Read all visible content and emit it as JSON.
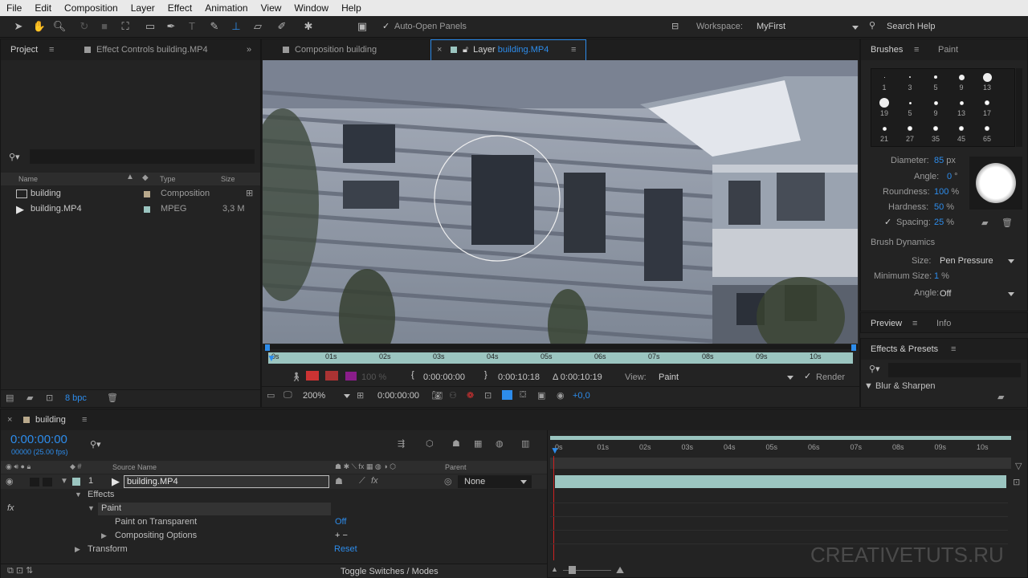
{
  "menu": [
    "File",
    "Edit",
    "Composition",
    "Layer",
    "Effect",
    "Animation",
    "View",
    "Window",
    "Help"
  ],
  "toolbar": {
    "auto_open": "Auto-Open Panels",
    "workspace_label": "Workspace:",
    "workspace_value": "MyFirst",
    "search_help": "Search Help"
  },
  "project_panel": {
    "tab_project": "Project",
    "tab_effect_controls": "Effect Controls building.MP4",
    "search_placeholder": "",
    "col_name": "Name",
    "col_type": "Type",
    "col_size": "Size",
    "items": [
      {
        "name": "building",
        "type": "Composition",
        "size": "",
        "color": "#b9a98c"
      },
      {
        "name": "building.MP4",
        "type": "MPEG",
        "size": "3,3 M",
        "color": "#9bc5c0"
      }
    ],
    "bpc": "8 bpc"
  },
  "viewer": {
    "tab_composition": "Composition building",
    "tab_layer_prefix": "Layer ",
    "tab_layer_name": "building.MP4",
    "ruler_labels": [
      "0s",
      "01s",
      "02s",
      "03s",
      "04s",
      "05s",
      "06s",
      "07s",
      "08s",
      "09s",
      "10s"
    ],
    "opacity": "100 %",
    "in_point": "0:00:00:00",
    "out_point": "0:00:10:18",
    "duration": "Δ 0:00:10:19",
    "view_label": "View:",
    "view_value": "Paint",
    "render_label": "Render",
    "zoom": "200%",
    "timecode": "0:00:00:00",
    "exposure": "+0,0"
  },
  "brushes": {
    "tab_brushes": "Brushes",
    "tab_paint": "Paint",
    "presets": [
      {
        "label": "1",
        "dot": 1
      },
      {
        "label": "3",
        "dot": 2
      },
      {
        "label": "5",
        "dot": 4
      },
      {
        "label": "9",
        "dot": 7
      },
      {
        "label": "13",
        "dot": 11
      },
      {
        "label": "19",
        "dot": 12
      },
      {
        "label": "5",
        "dot": 3
      },
      {
        "label": "9",
        "dot": 5
      },
      {
        "label": "13",
        "dot": 5
      },
      {
        "label": "17",
        "dot": 6
      },
      {
        "label": "21",
        "dot": 5
      },
      {
        "label": "27",
        "dot": 6
      },
      {
        "label": "35",
        "dot": 6
      },
      {
        "label": "45",
        "dot": 6
      },
      {
        "label": "65",
        "dot": 6
      }
    ],
    "diameter_label": "Diameter:",
    "diameter_value": "85",
    "diameter_unit": " px",
    "angle_label": "Angle:",
    "angle_value": "0",
    "angle_unit": " °",
    "roundness_label": "Roundness:",
    "roundness_value": "100",
    "roundness_unit": " %",
    "hardness_label": "Hardness:",
    "hardness_value": "50",
    "hardness_unit": " %",
    "spacing_label": "Spacing:",
    "spacing_value": "25",
    "spacing_unit": " %",
    "dynamics_label": "Brush Dynamics",
    "size_label": "Size:",
    "size_value": "Pen Pressure",
    "min_size_label": "Minimum Size:",
    "min_size_value": "1",
    "min_size_unit": " %",
    "dyn_angle_label": "Angle:",
    "dyn_angle_value": "Off"
  },
  "preview_panel": {
    "tab_preview": "Preview",
    "tab_info": "Info"
  },
  "effects_panel": {
    "title": "Effects & Presets",
    "search_placeholder": "",
    "category": "Blur & Sharpen"
  },
  "timeline": {
    "tab": "building",
    "timecode": "0:00:00:00",
    "fps": "00000 (25.00 fps)",
    "col_source": "Source Name",
    "col_parent": "Parent",
    "layer_number": "1",
    "layer_name": "building.MP4",
    "parent_value": "None",
    "effects": "Effects",
    "paint": "Paint",
    "paint_on_transparent": "Paint on Transparent",
    "paint_on_transparent_value": "Off",
    "compositing_options": "Compositing Options",
    "compositing_value": "+ −",
    "transform": "Transform",
    "transform_value": "Reset",
    "toggle": "Toggle Switches / Modes",
    "ruler_labels": [
      "0s",
      "01s",
      "02s",
      "03s",
      "04s",
      "05s",
      "06s",
      "07s",
      "08s",
      "09s",
      "10s"
    ]
  },
  "watermark": "CREATIVETUTS.RU"
}
